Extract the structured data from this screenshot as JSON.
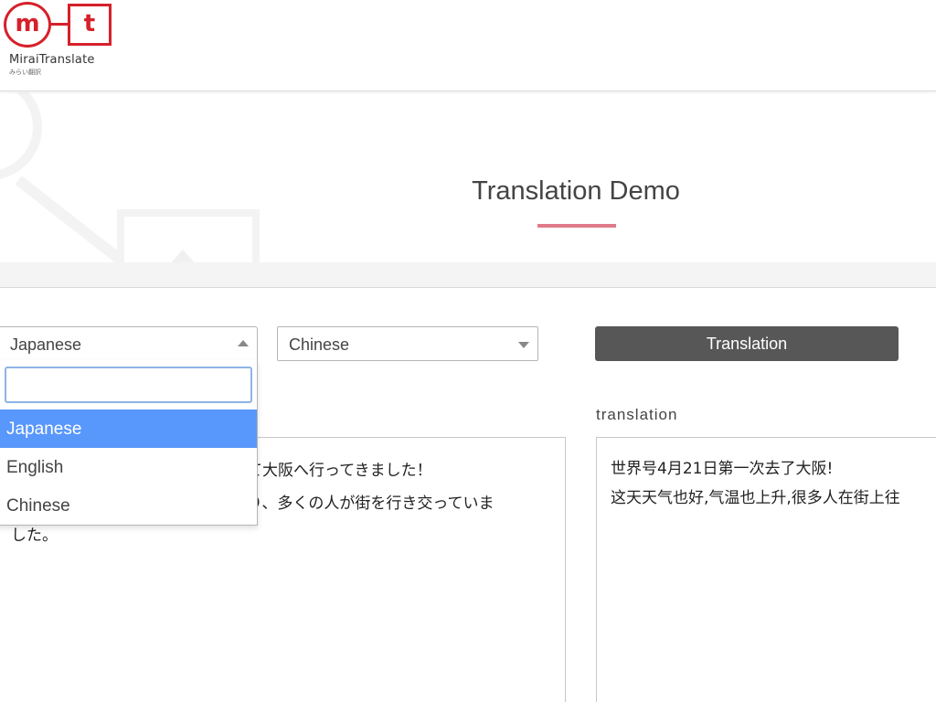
{
  "brand": {
    "logo_m": "m",
    "logo_t": "t",
    "name": "MiraiTranslate",
    "sub": "みらい翻訳"
  },
  "hero": {
    "title": "Translation Demo"
  },
  "source_select": {
    "value": "Japanese"
  },
  "target_select": {
    "value": "Chinese"
  },
  "dropdown": {
    "search_value": "",
    "options": [
      {
        "label": "Japanese",
        "selected": true
      },
      {
        "label": "English",
        "selected": false
      },
      {
        "label": "Chinese",
        "selected": false
      }
    ]
  },
  "translate_button": {
    "label": "Translation"
  },
  "output_label": "translation",
  "source_text": {
    "line1_visible": "て大阪へ行ってきました！",
    "line2_visible": "り、多くの人が街を行き交っていま",
    "line3": "した。"
  },
  "target_text": {
    "line1": "世界号4月21日第一次去了大阪!",
    "line2": "这天天气也好,气温也上升,很多人在街上往"
  },
  "colors": {
    "brand_red": "#d6202a",
    "accent_pink": "#e07a8a",
    "button_gray": "#575757",
    "selected_blue": "#5897fb"
  }
}
